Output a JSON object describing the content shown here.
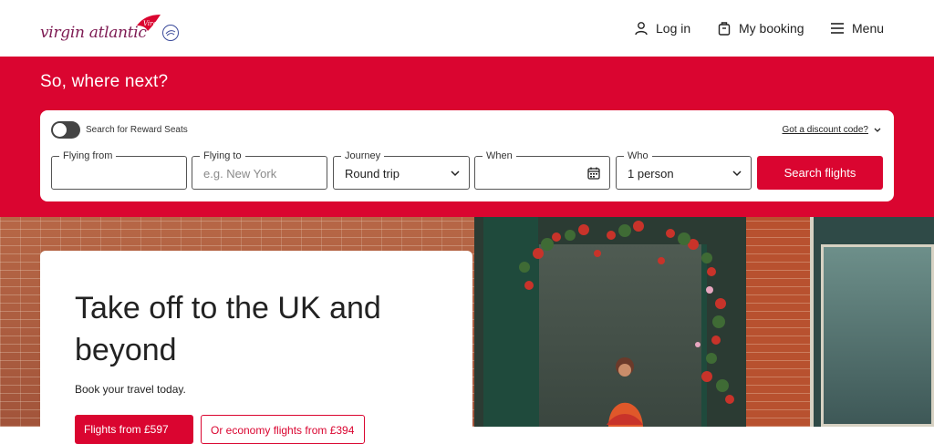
{
  "header": {
    "logo_text": "virgin atlantic",
    "login_label": "Log in",
    "booking_label": "My booking",
    "menu_label": "Menu"
  },
  "hero": {
    "tagline": "So, where next?"
  },
  "search": {
    "reward_label": "Search for Reward Seats",
    "discount_label": "Got a discount code?",
    "from": {
      "label": "Flying from",
      "value": ""
    },
    "to": {
      "label": "Flying to",
      "placeholder": "e.g. New York"
    },
    "journey": {
      "label": "Journey",
      "value": "Round trip"
    },
    "when": {
      "label": "When",
      "value": ""
    },
    "who": {
      "label": "Who",
      "value": "1 person"
    },
    "button_label": "Search flights"
  },
  "promo": {
    "title": "Take off to the UK and beyond",
    "subtitle": "Book your travel today.",
    "button1_label": "Flights from £597",
    "button2_label": "Or economy flights from £394"
  },
  "colors": {
    "brand_red": "#da0530",
    "logo_purple": "#7d1a52"
  },
  "icons": {
    "login": "user-icon",
    "booking": "briefcase-icon",
    "menu": "hamburger-icon",
    "calendar": "calendar-icon",
    "chevron": "chevron-down-icon"
  }
}
